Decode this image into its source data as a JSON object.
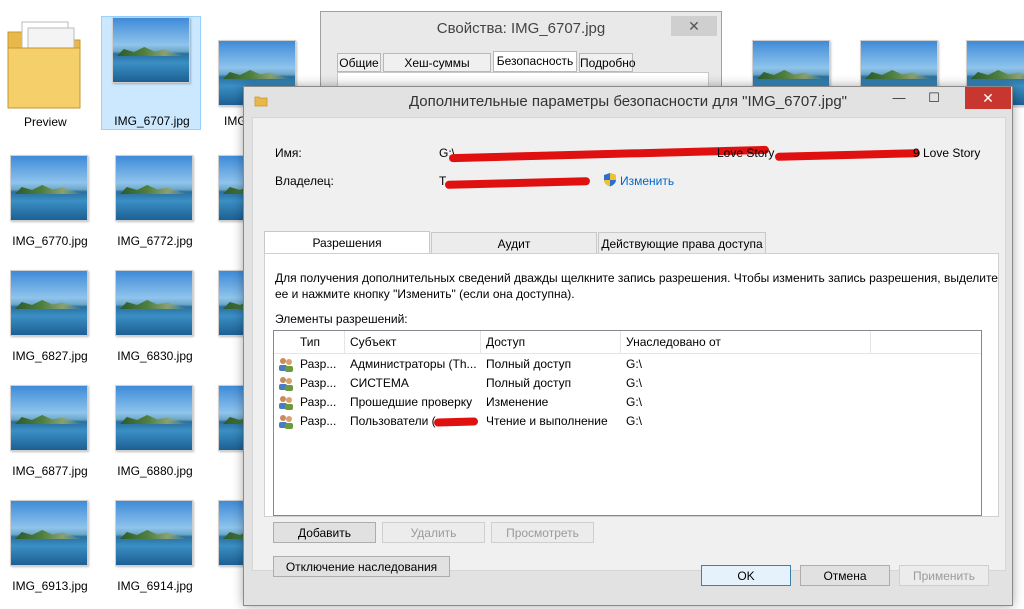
{
  "explorer": {
    "folder_label": "Preview",
    "files": [
      {
        "name": "IMG_6707.jpg",
        "selected": true
      },
      {
        "name": "IMG_6770.jpg"
      },
      {
        "name": "IMG_6772.jpg"
      },
      {
        "name": "IMG_6827.jpg"
      },
      {
        "name": "IMG_6830.jpg"
      },
      {
        "name": "IMG_6877.jpg"
      },
      {
        "name": "IMG_6880.jpg"
      },
      {
        "name": "IMG_6913.jpg"
      },
      {
        "name": "IMG_6914.jpg"
      }
    ],
    "partial_caption": "IMG"
  },
  "props_window": {
    "title": "Свойства: IMG_6707.jpg",
    "tabs": [
      "Общие",
      "Хеш-суммы файлов",
      "Безопасность",
      "Подробно"
    ],
    "active_tab": "Безопасность"
  },
  "advanced": {
    "title": "Дополнительные параметры безопасности  для \"IMG_6707.jpg\"",
    "minimize": "—",
    "maximize": "☐",
    "close": "✕",
    "name_label": "Имя:",
    "name_start": "G:\\",
    "name_mid": "Love Story",
    "name_end": "9 Love Story",
    "owner_label": "Владелец:",
    "owner_start": "T",
    "change_link": "Изменить",
    "tabs": [
      "Разрешения",
      "Аудит",
      "Действующие права доступа"
    ],
    "info_text": "Для получения дополнительных сведений дважды щелкните запись разрешения. Чтобы изменить запись разрешения, выделите",
    "info_text2": "ее и нажмите кнопку \"Изменить\" (если она доступна).",
    "entries_label": "Элементы разрешений:",
    "columns": [
      "Тип",
      "Субъект",
      "Доступ",
      "Унаследовано от"
    ],
    "rows": [
      {
        "type": "Разр...",
        "subject": "Администраторы (Th...",
        "access": "Полный доступ",
        "inherited": "G:\\"
      },
      {
        "type": "Разр...",
        "subject": "СИСТЕМА",
        "access": "Полный доступ",
        "inherited": "G:\\"
      },
      {
        "type": "Разр...",
        "subject": "Прошедшие проверку",
        "access": "Изменение",
        "inherited": "G:\\"
      },
      {
        "type": "Разр...",
        "subject": "Пользователи (",
        "access": "Чтение и выполнение",
        "inherited": "G:\\"
      }
    ],
    "btn_add": "Добавить",
    "btn_remove": "Удалить",
    "btn_view": "Просмотреть",
    "btn_disable_inheritance": "Отключение наследования",
    "btn_ok": "OK",
    "btn_cancel": "Отмена",
    "btn_apply": "Применить"
  }
}
